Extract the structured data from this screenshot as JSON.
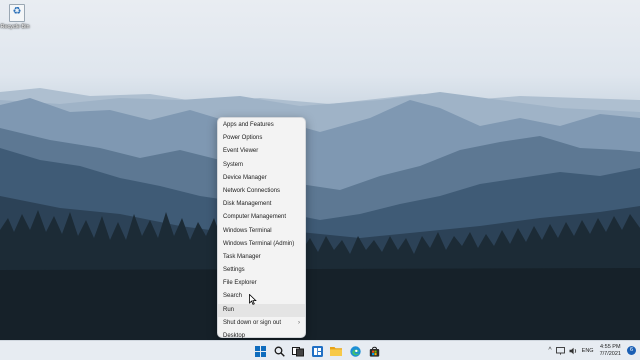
{
  "desktop": {
    "icons": [
      {
        "label": "Recycle Bin",
        "icon": "recycle-bin-icon"
      }
    ]
  },
  "winx_menu": {
    "items": [
      {
        "label": "Apps and Features"
      },
      {
        "label": "Power Options"
      },
      {
        "label": "Event Viewer"
      },
      {
        "label": "System"
      },
      {
        "label": "Device Manager"
      },
      {
        "label": "Network Connections"
      },
      {
        "label": "Disk Management"
      },
      {
        "label": "Computer Management"
      },
      {
        "label": "Windows Terminal"
      },
      {
        "label": "Windows Terminal (Admin)"
      },
      {
        "label": "Task Manager"
      },
      {
        "label": "Settings"
      },
      {
        "label": "File Explorer"
      },
      {
        "label": "Search"
      },
      {
        "label": "Run"
      },
      {
        "label": "Shut down or sign out",
        "submenu_arrow": "›"
      },
      {
        "label": "Desktop"
      }
    ],
    "hovered_item": "Run"
  },
  "taskbar": {
    "pinned": [
      "start-icon",
      "search-icon",
      "task-view-icon",
      "widgets-icon",
      "file-explorer-icon",
      "edge-icon",
      "store-icon"
    ],
    "tray": {
      "chevron": "^",
      "language": "ENG",
      "time": "4:55 PM",
      "date": "7/7/2021",
      "notification_count": "6"
    }
  },
  "colors": {
    "menu_background": "#f3f3f3",
    "taskbar_background": "#e7ecf2",
    "start_blue": "#0f6cbd",
    "notification_badge": "#1a5fb4"
  }
}
